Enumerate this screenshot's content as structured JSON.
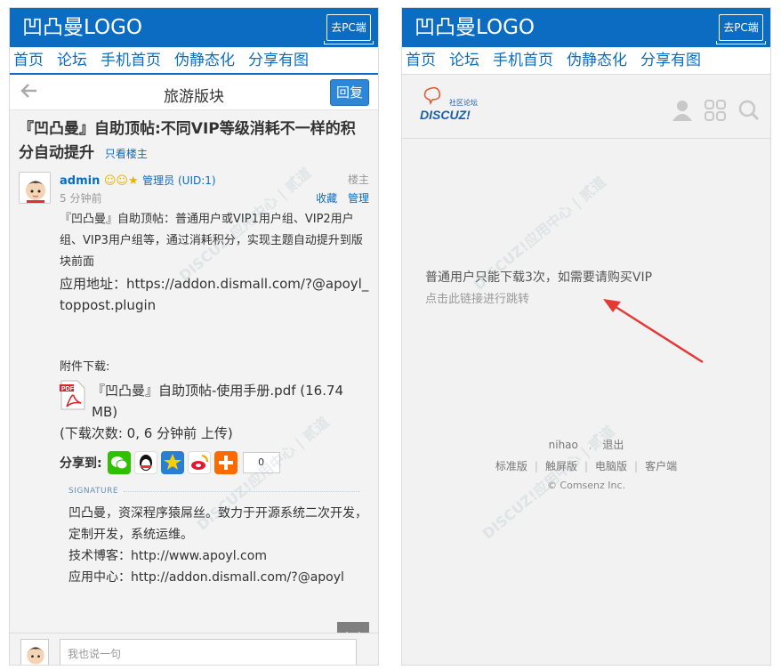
{
  "left": {
    "header": {
      "logo": "凹凸曼LOGO",
      "pc_button": "去PC端"
    },
    "nav": [
      "首页",
      "论坛",
      "手机首页",
      "伪静态化",
      "分享有图"
    ],
    "titlebar": {
      "title": "旅游版块",
      "reply": "回复"
    },
    "thread": {
      "title": "『凹凸曼』自助顶帖:不同VIP等级消耗不一样的积分自动提升",
      "only_author": "只看楼主"
    },
    "post": {
      "author": "admin",
      "group": "管理员 (UID:1)",
      "floor": "楼主",
      "time": "5 分钟前",
      "favorite": "收藏",
      "manage": "管理",
      "body": "『凹凸曼』自助顶帖：普通用户或VIP1用户组、VIP2用户组、VIP3用户组等，通过消耗积分，实现主题自动提升到版块前面",
      "app_label": "应用地址：https://addon.dismall.com/?@apoyl_toppost.plugin",
      "attach_label": "附件下载:",
      "attach_name": "『凹凸曼』自助顶帖-使用手册.pdf (16.74 MB)",
      "attach_meta": "(下载次数: 0, 6 分钟前 上传)"
    },
    "share": {
      "label": "分享到:",
      "count": "0"
    },
    "signature": {
      "label": "SIGNATURE",
      "line1": "凹凸曼，资深程序猿屌丝。致力于开源系统二次开发，定制开发，系统运维。",
      "line2": "技术博客：http://www.apoyl.com",
      "line3": "应用中心：http://addon.dismall.com/?@apoyl"
    },
    "reply_box": {
      "placeholder": "我也说一句"
    }
  },
  "right": {
    "header": {
      "logo": "凹凸曼LOGO",
      "pc_button": "去PC端"
    },
    "nav": [
      "首页",
      "论坛",
      "手机首页",
      "伪静态化",
      "分享有图"
    ],
    "discuz": {
      "small": "社区论坛",
      "big": "DISCUZ!"
    },
    "message": "普通用户只能下载3次，如需要请购买VIP",
    "message_link": "点击此链接进行跳转",
    "footer": {
      "user": "nihao",
      "logout": "退出",
      "links": [
        "标准版",
        "触屏版",
        "电脑版",
        "客户端"
      ],
      "copyright": "© Comsenz Inc."
    }
  },
  "colors": {
    "brand": "#0b6cc2",
    "arrow": "#e53935"
  }
}
